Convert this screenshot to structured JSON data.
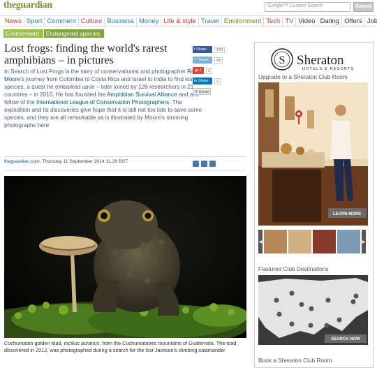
{
  "masthead": {
    "logo_the": "the",
    "logo_guardian": "guardian",
    "search_placeholder": "Google™ Custom Search",
    "search_button": "Search"
  },
  "nav": {
    "items": [
      {
        "label": "News",
        "color": "#c0392b"
      },
      {
        "label": "Sport",
        "color": "#2a7ab0"
      },
      {
        "label": "Comment",
        "color": "#2a7ab0"
      },
      {
        "label": "Culture",
        "color": "#b03a72"
      },
      {
        "label": "Business",
        "color": "#2a7ab0"
      },
      {
        "label": "Money",
        "color": "#2a7ab0"
      },
      {
        "label": "Life & style",
        "color": "#c0392b"
      },
      {
        "label": "Travel",
        "color": "#2a7ab0"
      },
      {
        "label": "Environment",
        "color": "#6b8e23"
      },
      {
        "label": "Tech",
        "color": "#c0392b"
      },
      {
        "label": "TV",
        "color": "#c0392b"
      },
      {
        "label": "Video",
        "color": "#333333"
      },
      {
        "label": "Dating",
        "color": "#333333"
      },
      {
        "label": "Offers",
        "color": "#333333"
      },
      {
        "label": "Jobs",
        "color": "#333333"
      }
    ]
  },
  "breadcrumb": {
    "items": [
      "Environment",
      "Endangered species"
    ]
  },
  "article": {
    "headline": "Lost frogs: finding the world's rarest amphibians – in pictures",
    "standfirst_1": "In Search of Lost Frogs is the story of conservationist and photographer ",
    "standfirst_link_1": "Robin Moore",
    "standfirst_2": "'s journey from Colombia to Costa Rica and Israel to India to find lost species, a quest he embarked upon – later joined by 126 researchers in 21 countries – in 2010. He has founded the ",
    "standfirst_link_2": "Amphibian Survival Alliance",
    "standfirst_3": " and is a fellow of the ",
    "standfirst_link_3": "International League of Conservation Photographers",
    "standfirst_4": ". The expedition and its discoveries give hope that it is still not too late to save some species, and they are all remarkable as is illustrated by Moore's stunning photographs here",
    "byline_site": "theguardian.com",
    "byline_date": ", Thursday 11 September 2014 11.29 BST",
    "caption_1": "Cuchumatan golden toad, ",
    "caption_latin": "Incilius aurarius",
    "caption_2": ", from the Cuchumatanes mountains of Guatemala. The toad, discovered in 2012, was photographed during a search for the lost Jackson's climbing salamander"
  },
  "share": {
    "facebook": {
      "label": "Share",
      "count": "379"
    },
    "twitter": {
      "label": "Tweet",
      "count": "68"
    },
    "gplus": {
      "label": "g+1",
      "count": "1"
    },
    "linkedin": {
      "label": "Share",
      "count": "2"
    },
    "email": {
      "label": "Email"
    }
  },
  "ad": {
    "brand": "Sheraton",
    "brand_sub": "HOTELS & RESORTS",
    "heading_1": "Upgrade to a Sheraton Club Room",
    "learn_more": "LEARN MORE",
    "heading_2": "Featured Club Destinations",
    "search_now": "SEARCH NOW",
    "heading_3": "Book a Sheraton Club Room"
  }
}
